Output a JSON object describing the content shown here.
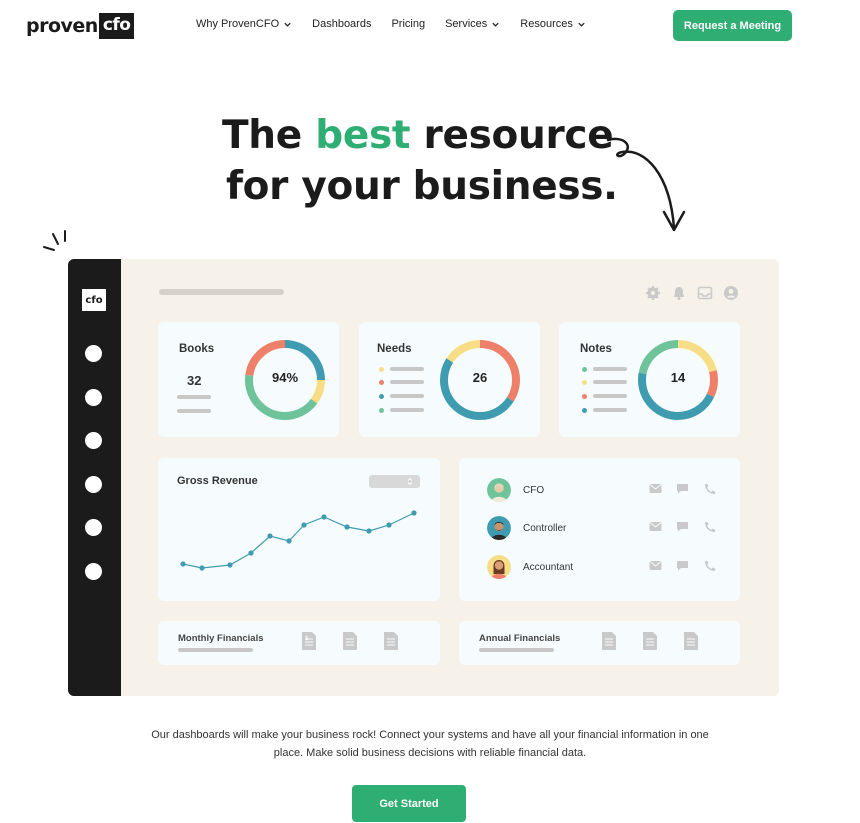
{
  "header": {
    "logo": {
      "word": "proven",
      "box": "cfo"
    },
    "nav": [
      {
        "label": "Why ProvenCFO",
        "has_dropdown": true
      },
      {
        "label": "Dashboards",
        "has_dropdown": false
      },
      {
        "label": "Pricing",
        "has_dropdown": false
      },
      {
        "label": "Services",
        "has_dropdown": true
      },
      {
        "label": "Resources",
        "has_dropdown": true
      }
    ],
    "cta_label": "Request a Meeting"
  },
  "hero": {
    "line1_prefix": "The ",
    "line1_accent": "best",
    "line1_suffix": " resource",
    "line2": "for your business."
  },
  "dashboard": {
    "sidebar_logo": "cfo",
    "top_icons": [
      "gear-icon",
      "bell-icon",
      "inbox-icon",
      "user-icon"
    ],
    "cards": {
      "books": {
        "title": "Books",
        "value": "32",
        "donut_label": "94%"
      },
      "needs": {
        "title": "Needs",
        "donut_label": "26"
      },
      "notes": {
        "title": "Notes",
        "donut_label": "14"
      }
    },
    "revenue": {
      "title": "Gross Revenue"
    },
    "contacts": [
      {
        "role": "CFO",
        "avatar": "avatar-cfo"
      },
      {
        "role": "Controller",
        "avatar": "avatar-controller"
      },
      {
        "role": "Accountant",
        "avatar": "avatar-accountant"
      }
    ],
    "financials": {
      "monthly": "Monthly Financials",
      "annual": "Annual Financials"
    }
  },
  "description": "Our dashboards will make your business rock! Connect your systems and have all your financial information in one place. Make solid business decisions with reliable financial data.",
  "cta_bottom_label": "Get Started",
  "colors": {
    "brand_green": "#2fae73",
    "teal": "#3f9bb0",
    "green": "#6fc39b",
    "yellow": "#f7de86",
    "coral": "#ee7f69",
    "dark": "#1b1b1b"
  }
}
